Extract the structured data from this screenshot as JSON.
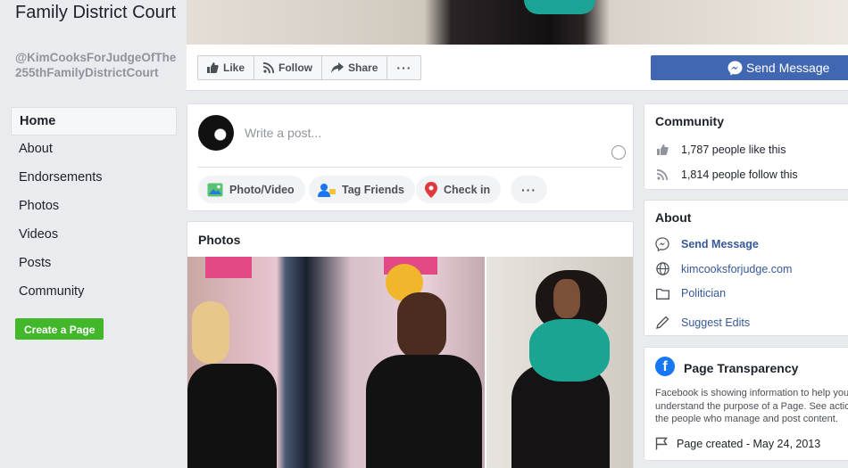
{
  "page": {
    "name": "Family District Court",
    "handle": "@KimCooksForJudgeOfThe255thFamilyDistrictCourt"
  },
  "nav": {
    "items": [
      {
        "label": "Home",
        "active": true
      },
      {
        "label": "About"
      },
      {
        "label": "Endorsements"
      },
      {
        "label": "Photos"
      },
      {
        "label": "Videos"
      },
      {
        "label": "Posts"
      },
      {
        "label": "Community"
      }
    ],
    "create_page": "Create a Page"
  },
  "actions": {
    "like": "Like",
    "follow": "Follow",
    "share": "Share",
    "more": "···",
    "send_message": "Send Message"
  },
  "composer": {
    "placeholder": "Write a post...",
    "photo_video": "Photo/Video",
    "tag_friends": "Tag Friends",
    "check_in": "Check in",
    "more": "···"
  },
  "photos": {
    "title": "Photos"
  },
  "community": {
    "title": "Community",
    "likes": "1,787 people like this",
    "follows": "1,814 people follow this"
  },
  "about": {
    "title": "About",
    "send_message": "Send Message",
    "website": "kimcooksforjudge.com",
    "category": "Politician",
    "suggest_edits": "Suggest Edits"
  },
  "transparency": {
    "title": "Page Transparency",
    "desc_lines": [
      "Facebook is showing information to help you",
      "understand the purpose of a Page. See actio",
      "the people who manage and post content."
    ],
    "created": "Page created - May 24, 2013"
  },
  "colors": {
    "brand_blue": "#4267b2",
    "link_blue": "#365899",
    "green": "#42b72a",
    "background": "#e9ebee"
  }
}
